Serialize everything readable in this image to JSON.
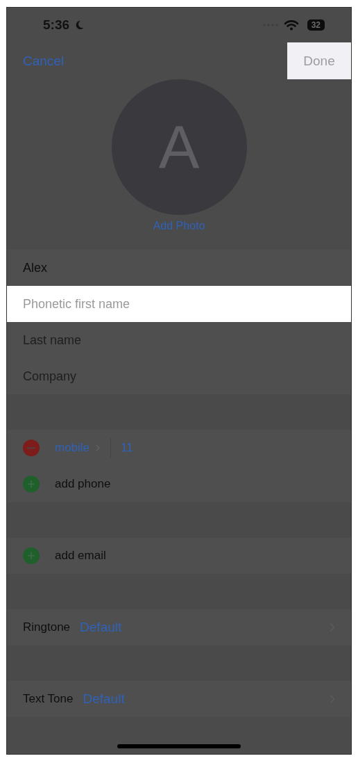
{
  "status_bar": {
    "time": "5:36",
    "battery": "32"
  },
  "nav": {
    "cancel": {
      "label": "Cancel",
      "highlighted": false
    },
    "done": {
      "label": "Done",
      "highlighted": true
    }
  },
  "avatar": {
    "initial": "A",
    "add_photo": "Add Photo"
  },
  "name_fields": [
    {
      "value": "Alex",
      "highlighted": false
    },
    {
      "placeholder": "Phonetic first name",
      "highlighted": true
    },
    {
      "placeholder": "Last name",
      "highlighted": false
    },
    {
      "placeholder": "Company",
      "highlighted": false
    }
  ],
  "phones": [
    {
      "label": "mobile",
      "value": "11"
    }
  ],
  "add_phone": "add phone",
  "add_email": "add email",
  "tones": [
    {
      "label": "Ringtone",
      "value": "Default"
    },
    {
      "label": "Text Tone",
      "value": "Default"
    }
  ]
}
